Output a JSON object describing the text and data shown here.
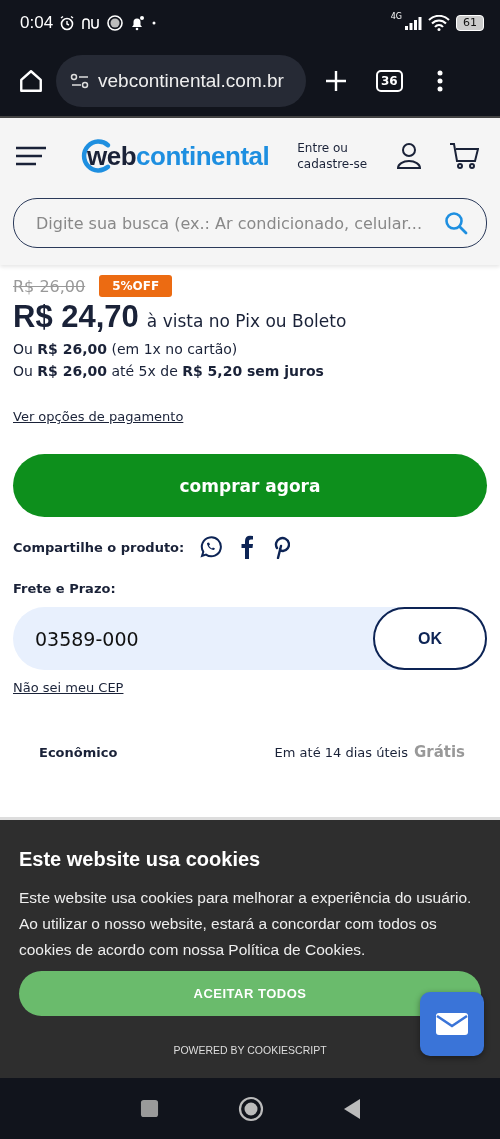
{
  "status_bar": {
    "time": "0:04",
    "network": "4G",
    "battery": "61"
  },
  "browser": {
    "url": "vebcontinental.com.br",
    "tab_count": "36"
  },
  "header": {
    "logo_dark": "web",
    "logo_blue": "continental",
    "login": "Entre ou cadastre-se",
    "search": {
      "placeholder": "Digite sua busca (ex.: Ar condicionado, celular..."
    }
  },
  "price": {
    "old": "R$ 26,00",
    "discount": "5%OFF",
    "current": "R$ 24,70",
    "current_note": "à vista no Pix ou Boleto",
    "lines": [
      "Ou **R$ 26,00** (em 1x no cartão)",
      "Ou **R$ 26,00** até 5x de **R$ 5,20 sem juros**"
    ],
    "payment_link": "Ver opções de pagamento"
  },
  "buy_button": "comprar agora",
  "share": {
    "label": "Compartilhe o produto:"
  },
  "shipping": {
    "label": "Frete e Prazo:",
    "cep": "03589-000",
    "ok": "OK",
    "cep_link": "Não sei meu CEP",
    "options": [
      {
        "name": "Econômico",
        "time": "Em até 14 dias úteis",
        "cost": "Grátis"
      }
    ]
  },
  "cookies": {
    "title": "Este website usa cookies",
    "text": "Este website usa cookies para melhorar a experiência do usuário. Ao utilizar o nosso website, estará a concordar com todos os cookies de acordo com nossa Política de Cookies.",
    "accept": "ACEITAR TODOS",
    "powered": "POWERED BY COOKIESCRIPT"
  }
}
